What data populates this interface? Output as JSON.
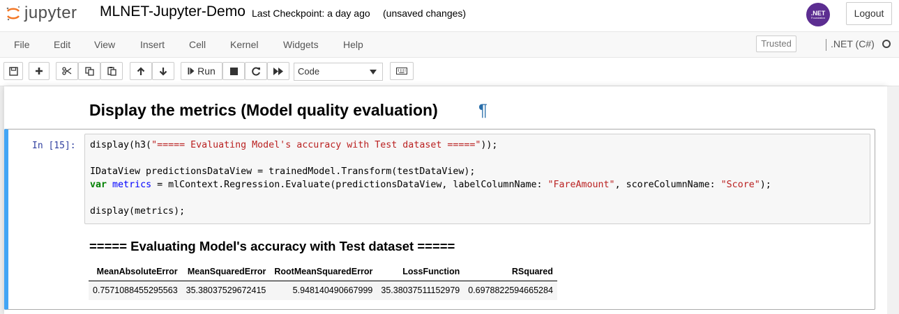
{
  "header": {
    "logo_text": "jupyter",
    "notebook_title": "MLNET-Jupyter-Demo",
    "checkpoint": "Last Checkpoint: a day ago",
    "save_status": "(unsaved changes)",
    "dotnet_logo_text": ".NET",
    "dotnet_logo_sub": "Foundation",
    "logout_label": "Logout"
  },
  "menubar": {
    "items": [
      "File",
      "Edit",
      "View",
      "Insert",
      "Cell",
      "Kernel",
      "Widgets",
      "Help"
    ],
    "trusted_label": "Trusted",
    "kernel_name": ".NET (C#)"
  },
  "toolbar": {
    "run_label": "Run",
    "cell_type": "Code",
    "icons": [
      "save-icon",
      "plus-icon",
      "cut-icon",
      "copy-icon",
      "paste-icon",
      "arrow-up-icon",
      "arrow-down-icon",
      "step-forward-icon",
      "stop-icon",
      "restart-icon",
      "fast-forward-icon",
      "keyboard-icon"
    ]
  },
  "notebook": {
    "markdown_heading": "Display the metrics (Model quality evaluation)",
    "anchor_symbol": "¶",
    "cell": {
      "prompt": "In [15]:",
      "code": {
        "l1_a": "display(h3(",
        "l1_str": "\"===== Evaluating Model's accuracy with Test dataset =====\"",
        "l1_b": "));",
        "l2": "IDataView predictionsDataView = trainedModel.Transform(testDataView);",
        "l3_kw": "var",
        "l3_var": "metrics",
        "l3_a": " = mlContext.Regression.Evaluate(predictionsDataView, labelColumnName: ",
        "l3_str1": "\"FareAmount\"",
        "l3_b": ", scoreColumnName: ",
        "l3_str2": "\"Score\"",
        "l3_c": ");",
        "l4": "display(metrics);"
      },
      "output": {
        "heading": "===== Evaluating Model's accuracy with Test dataset =====",
        "table": {
          "columns": [
            "MeanAbsoluteError",
            "MeanSquaredError",
            "RootMeanSquaredError",
            "LossFunction",
            "RSquared"
          ],
          "rows": [
            [
              "0.7571088455295563",
              "35.38037529672415",
              "5.948140490667999",
              "35.38037511152979",
              "0.6978822594665284"
            ]
          ]
        }
      }
    }
  },
  "colors": {
    "selected_cell_border": "#42a5f5",
    "prompt": "#303f9f",
    "string": "#ba2121",
    "keyword": "#008000",
    "variable": "#0000ff",
    "anchor": "#296eaa"
  }
}
